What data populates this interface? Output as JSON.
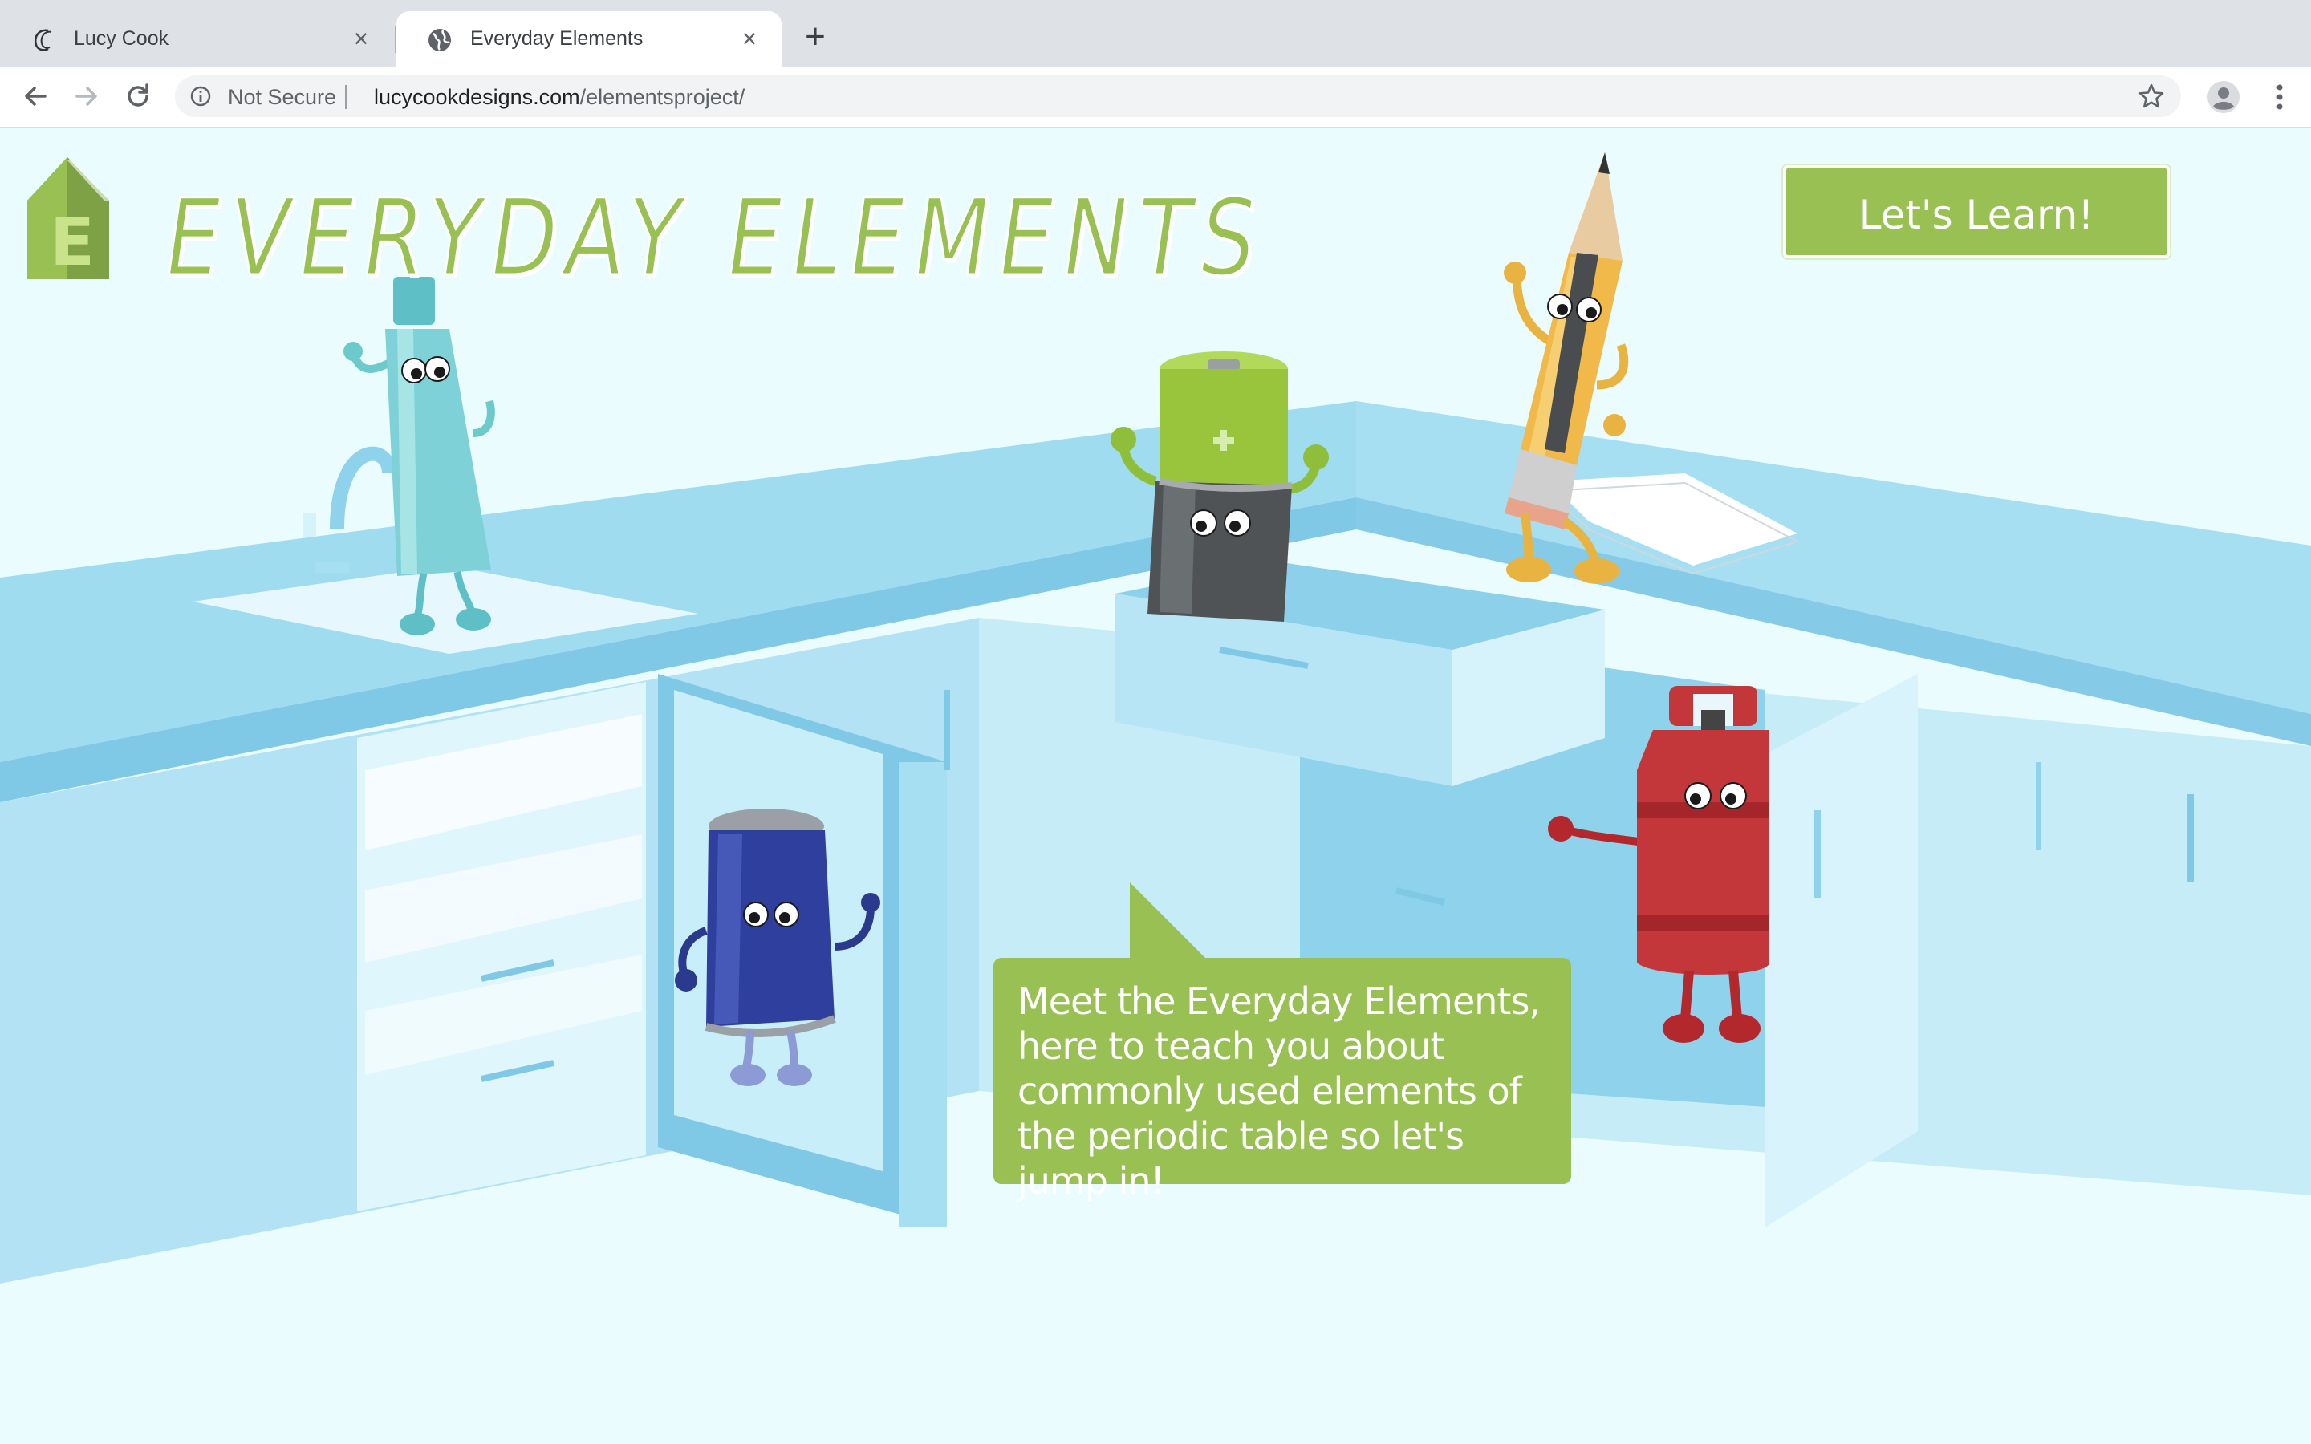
{
  "browser": {
    "tabs": [
      {
        "title": "Lucy Cook",
        "icon": "lucy-cook-favicon",
        "active": false
      },
      {
        "title": "Everyday Elements",
        "icon": "globe-icon",
        "active": true
      }
    ],
    "close_glyph": "×",
    "new_tab_glyph": "+",
    "security_label": "Not Secure",
    "url_domain": "lucycookdesigns.com",
    "url_path": "/elementsproject/"
  },
  "page": {
    "site_title": "EVERYDAY ELEMENTS",
    "logo_letter": "E",
    "cta_label": "Let's Learn!",
    "speech_bubble": "Meet the Everyday Elements, here to teach you about commonly used elements of the periodic table so let's jump in!",
    "characters": [
      "toothpaste",
      "battery",
      "pencil",
      "soda-can",
      "gas-cylinder"
    ]
  },
  "colors": {
    "accent_green": "#98c053",
    "page_background": "#eafcfd",
    "counter_blue": "#9fdcf0",
    "cabinet_blue": "#bde8f6"
  }
}
